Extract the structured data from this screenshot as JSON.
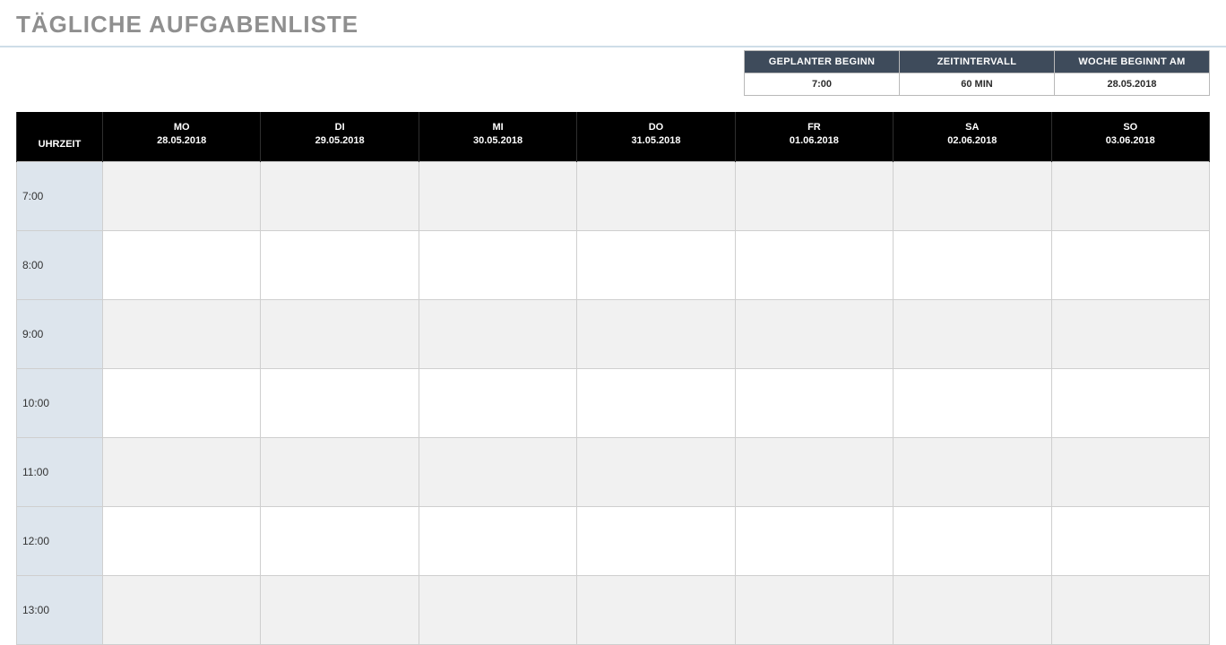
{
  "title": "TÄGLICHE AUFGABENLISTE",
  "settings": {
    "headers": {
      "start": "GEPLANTER BEGINN",
      "interval": "ZEITINTERVALL",
      "weekstart": "WOCHE BEGINNT AM"
    },
    "values": {
      "start": "7:00",
      "interval": "60 MIN",
      "weekstart": "28.05.2018"
    }
  },
  "calendar": {
    "time_header": "UHRZEIT",
    "days": [
      {
        "dow": "MO",
        "date": "28.05.2018"
      },
      {
        "dow": "DI",
        "date": "29.05.2018"
      },
      {
        "dow": "MI",
        "date": "30.05.2018"
      },
      {
        "dow": "DO",
        "date": "31.05.2018"
      },
      {
        "dow": "FR",
        "date": "01.06.2018"
      },
      {
        "dow": "SA",
        "date": "02.06.2018"
      },
      {
        "dow": "SO",
        "date": "03.06.2018"
      }
    ],
    "times": [
      "7:00",
      "8:00",
      "9:00",
      "10:00",
      "11:00",
      "12:00",
      "13:00"
    ]
  }
}
